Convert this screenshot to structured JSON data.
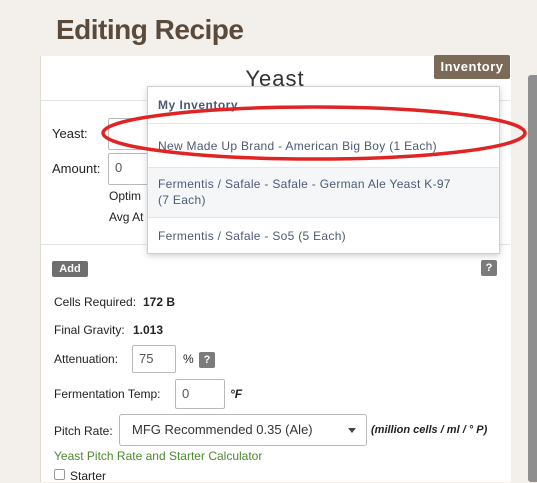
{
  "page": {
    "title": "Editing Recipe"
  },
  "panel": {
    "section_title": "Yeast",
    "inventory_label": "Inventory",
    "yeast_label": "Yeast:",
    "amount_label": "Amount:",
    "amount_value": "0",
    "optimal_partial": "Optim",
    "avg_partial": "Avg At",
    "add_label": "Add",
    "help_glyph": "?",
    "cells_required_label": "Cells Required:",
    "cells_required_value": "172 B",
    "final_gravity_label": "Final Gravity:",
    "final_gravity_value": "1.013",
    "attenuation_label": "Attenuation:",
    "attenuation_value": "75",
    "attenuation_unit": "%",
    "fermentation_temp_label": "Fermentation Temp:",
    "fermentation_temp_value": "0",
    "fermentation_temp_unit": "°F",
    "pitch_rate_label": "Pitch Rate:",
    "pitch_rate_selected": "MFG Recommended 0.35 (Ale)",
    "pitch_rate_unit": "(million cells / ml / ° P)",
    "calculator_link": "Yeast Pitch Rate and Starter Calculator",
    "starter_label": "Starter"
  },
  "inventory_dropdown": {
    "header": "My Inventory",
    "items": [
      {
        "label": "New Made Up Brand - American Big Boy (1 Each)"
      },
      {
        "line1": "Fermentis / Safale - Safale - German Ale Yeast K-97",
        "line2": "(7 Each)"
      },
      {
        "label": "Fermentis / Safale - So5 (5 Each)"
      }
    ]
  },
  "colors": {
    "brand_brown": "#7b6a58",
    "title_brown": "#5a4a3c",
    "link_green": "#4c8a2f",
    "dropdown_text": "#4d5a75",
    "annotation_red": "#e02424"
  },
  "annotation": {
    "shape": "red-oval",
    "target": "inventory_dropdown.items.0"
  }
}
